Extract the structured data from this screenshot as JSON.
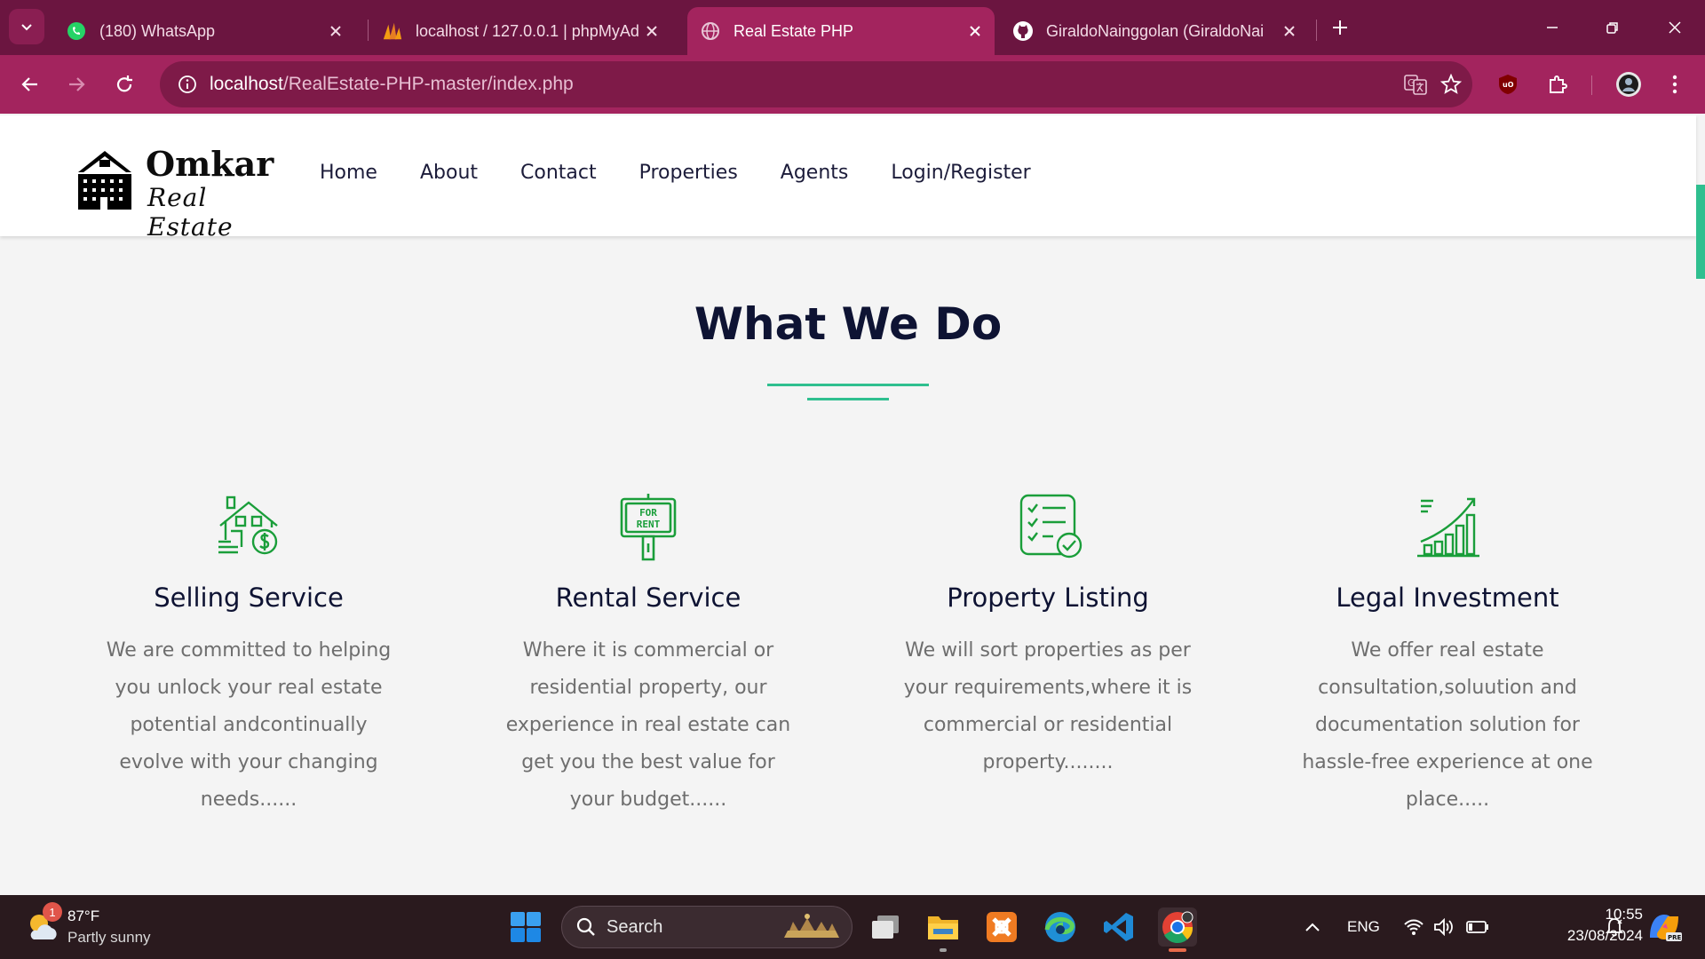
{
  "browser": {
    "tabs": [
      {
        "title": "(180) WhatsApp",
        "icon": "whatsapp-icon",
        "active": false
      },
      {
        "title": "localhost / 127.0.0.1 | phpMyAd",
        "icon": "phpmyadmin-icon",
        "active": false
      },
      {
        "title": "Real Estate PHP",
        "icon": "globe-icon",
        "active": true
      },
      {
        "title": "GiraldoNainggolan (GiraldoNai",
        "icon": "github-icon",
        "active": false
      }
    ],
    "url_host": "localhost",
    "url_path": "/RealEstate-PHP-master/index.php",
    "colors": {
      "frame": "#6b1540",
      "toolbar": "#a3245e",
      "omnibox": "#7e1a48"
    }
  },
  "site": {
    "logo": {
      "name": "Omkar",
      "subtitle": "Real Estate"
    },
    "nav": [
      "Home",
      "About",
      "Contact",
      "Properties",
      "Agents",
      "Login/Register"
    ],
    "section_title": "What We Do",
    "accent_color": "#2fbf8f",
    "icon_color": "#1a9e3a",
    "services": [
      {
        "icon": "house-sale-icon",
        "title": "Selling Service",
        "text": "We are committed to helping you unlock your real estate potential andcontinually evolve with your changing needs......"
      },
      {
        "icon": "for-rent-sign-icon",
        "title": "Rental Service",
        "text": "Where it is commercial or residential property, our experience in real estate can get you the best value for your budget......"
      },
      {
        "icon": "checklist-icon",
        "title": "Property Listing",
        "text": "We will sort properties as per your requirements,where it is commercial or residential property........"
      },
      {
        "icon": "growth-chart-icon",
        "title": "Legal Investment",
        "text": "We offer real estate consultation,soluution and documentation solution for hassle-free experience at one place....."
      }
    ],
    "for_rent_sign": {
      "line1": "FOR",
      "line2": "RENT"
    }
  },
  "taskbar": {
    "weather": {
      "temp": "87°F",
      "condition": "Partly sunny",
      "badge": "1"
    },
    "search_label": "Search",
    "language": "ENG",
    "time": "10:55",
    "date": "23/08/2024"
  }
}
